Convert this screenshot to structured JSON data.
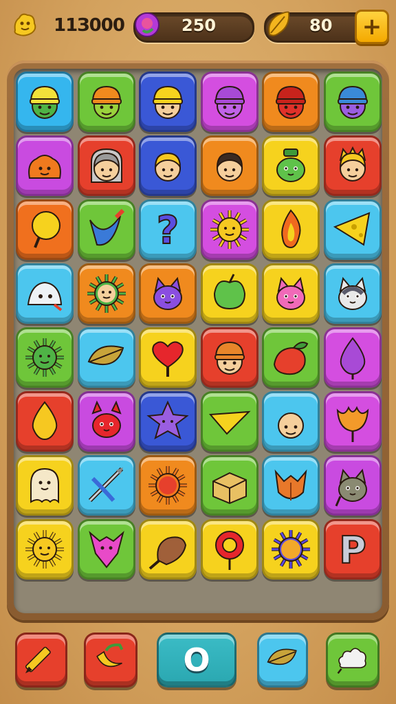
{
  "hud": {
    "coins": "11З000",
    "gems": "250",
    "leaves": "80",
    "plus_label": "+"
  },
  "board": {
    "rows": [
      [
        {
          "color": "#35b6ee",
          "icon": "green-hat-face"
        },
        {
          "color": "#6fc63a",
          "icon": "lime-hat-face"
        },
        {
          "color": "#3a58d6",
          "icon": "yellow-hat-face"
        },
        {
          "color": "#d44ee0",
          "icon": "purple-hat-face"
        },
        {
          "color": "#f08a1e",
          "icon": "red-hat-face"
        },
        {
          "color": "#6fc63a",
          "icon": "violet-hat-face"
        }
      ],
      [
        {
          "color": "#c94be0",
          "icon": "orange-blob"
        },
        {
          "color": "#e6402c",
          "icon": "grey-hood-face"
        },
        {
          "color": "#3a58d6",
          "icon": "blond-face"
        },
        {
          "color": "#f08a1e",
          "icon": "dark-hair-face"
        },
        {
          "color": "#f6d21e",
          "icon": "green-frog"
        },
        {
          "color": "#e6402c",
          "icon": "crown-face"
        }
      ],
      [
        {
          "color": "#f0701e",
          "icon": "yellow-lollipop"
        },
        {
          "color": "#6fc63a",
          "icon": "blue-carrot"
        },
        {
          "color": "#4cc6ee",
          "icon": "question-mark"
        },
        {
          "color": "#d44ee0",
          "icon": "sun-face"
        },
        {
          "color": "#f6d21e",
          "icon": "flame"
        },
        {
          "color": "#4cc6ee",
          "icon": "cheese"
        }
      ],
      [
        {
          "color": "#4cc6ee",
          "icon": "white-fish"
        },
        {
          "color": "#f08a1e",
          "icon": "spiky-face"
        },
        {
          "color": "#f08a1e",
          "icon": "purple-cat"
        },
        {
          "color": "#f6d21e",
          "icon": "green-apple"
        },
        {
          "color": "#f6d21e",
          "icon": "pink-cat"
        },
        {
          "color": "#4cc6ee",
          "icon": "husky"
        }
      ],
      [
        {
          "color": "#6fc63a",
          "icon": "green-sun"
        },
        {
          "color": "#4cc6ee",
          "icon": "leaf"
        },
        {
          "color": "#f6d21e",
          "icon": "heart-lollipop"
        },
        {
          "color": "#e6402c",
          "icon": "beanie-face"
        },
        {
          "color": "#6fc63a",
          "icon": "red-berry"
        },
        {
          "color": "#d44ee0",
          "icon": "purple-drop"
        }
      ],
      [
        {
          "color": "#e6402c",
          "icon": "yellow-drop"
        },
        {
          "color": "#c94be0",
          "icon": "red-devil"
        },
        {
          "color": "#3a58d6",
          "icon": "purple-star"
        },
        {
          "color": "#6fc63a",
          "icon": "yellow-wedge"
        },
        {
          "color": "#4cc6ee",
          "icon": "bald-face"
        },
        {
          "color": "#d44ee0",
          "icon": "orange-tulip"
        }
      ],
      [
        {
          "color": "#f6d21e",
          "icon": "ghost"
        },
        {
          "color": "#4cc6ee",
          "icon": "crossbow"
        },
        {
          "color": "#f08a1e",
          "icon": "red-sun"
        },
        {
          "color": "#6fc63a",
          "icon": "cheese-block"
        },
        {
          "color": "#4cc6ee",
          "icon": "fox"
        },
        {
          "color": "#c94be0",
          "icon": "grey-cat"
        }
      ],
      [
        {
          "color": "#f6d21e",
          "icon": "smiling-sun"
        },
        {
          "color": "#6fc63a",
          "icon": "pink-bat"
        },
        {
          "color": "#f6d21e",
          "icon": "acorn"
        },
        {
          "color": "#f6d21e",
          "icon": "red-ring"
        },
        {
          "color": "#f6d21e",
          "icon": "spiky-orb"
        },
        {
          "color": "#e6402c",
          "icon": "letter-p",
          "label": "P"
        }
      ]
    ]
  },
  "toolbar": {
    "center_label": "O",
    "buttons": [
      {
        "color": "#e6402c",
        "icon": "crayon"
      },
      {
        "color": "#e6402c",
        "icon": "banana"
      },
      {
        "color": "#2aa7b0",
        "icon": "toggle"
      },
      {
        "color": "#4cc6ee",
        "icon": "leaf"
      },
      {
        "color": "#6fc63a",
        "icon": "cloud"
      }
    ]
  }
}
